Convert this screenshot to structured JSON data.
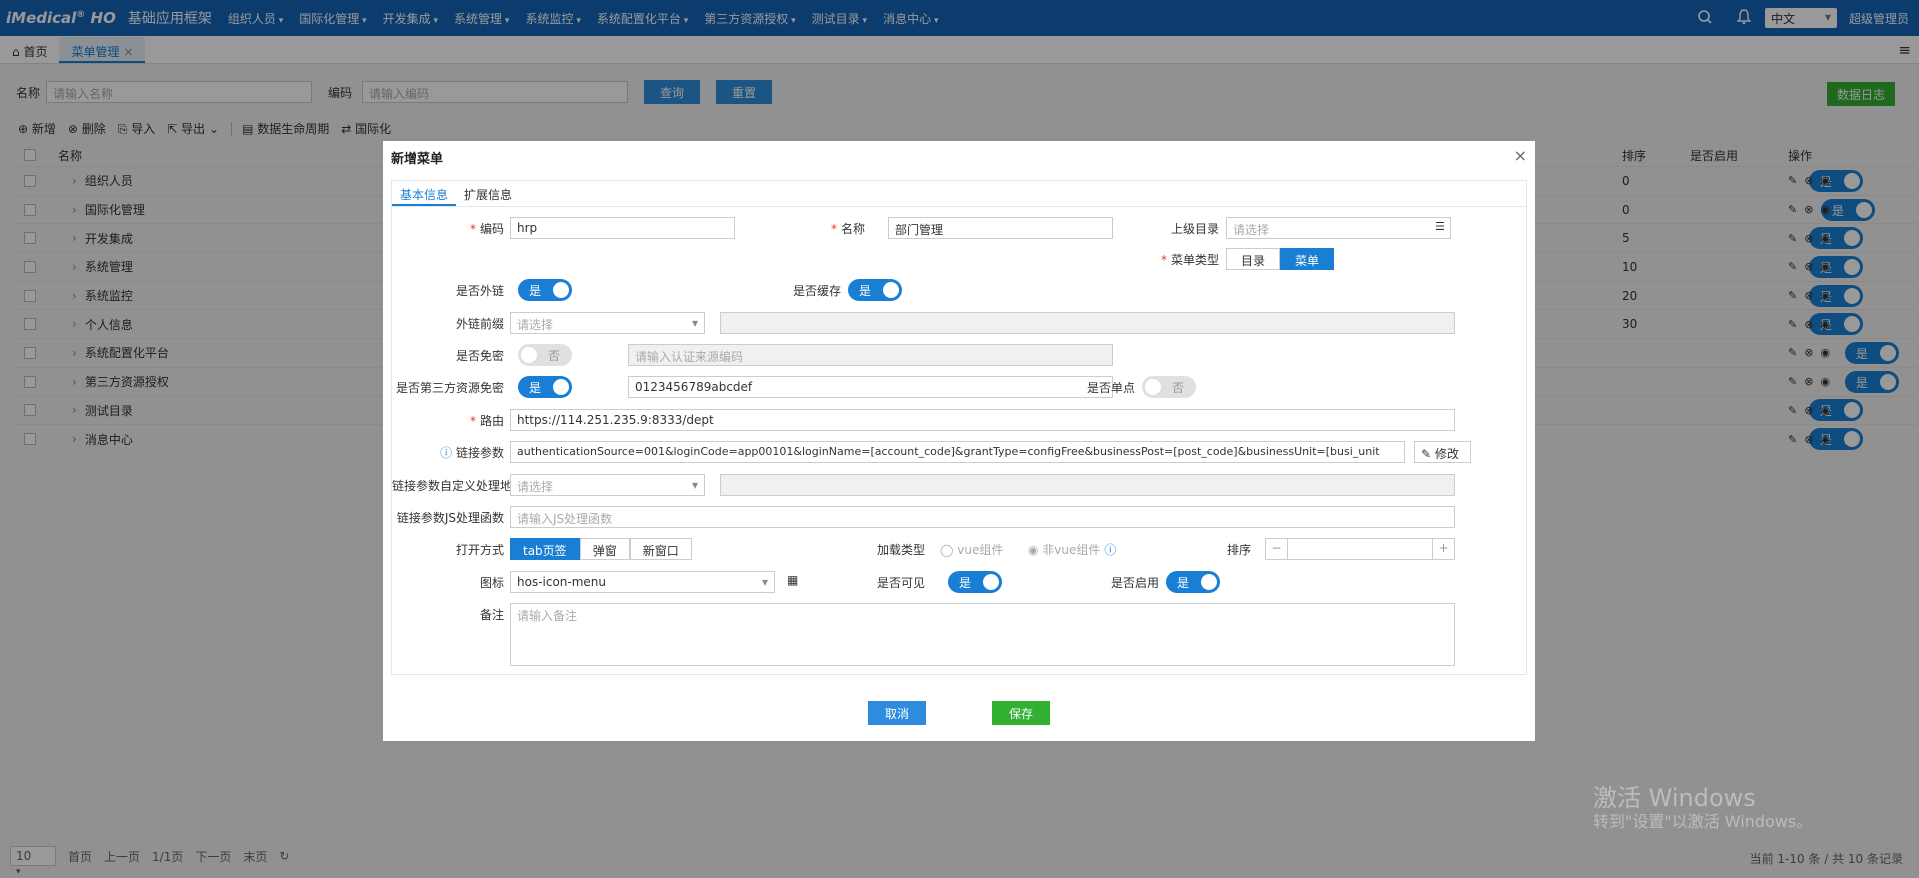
{
  "header": {
    "logo": "iMedical",
    "logo_sup": "®",
    "logo_suffix": "HO",
    "app_title": "基础应用框架",
    "nav": [
      "组织人员",
      "国际化管理",
      "开发集成",
      "系统管理",
      "系统监控",
      "系统配置化平台",
      "第三方资源授权",
      "测试目录",
      "消息中心"
    ],
    "language": "中文",
    "user": "超级管理员"
  },
  "tabs": {
    "home": "首页",
    "active": "菜单管理",
    "close": "×"
  },
  "search": {
    "name_label": "名称",
    "name_placeholder": "请输入名称",
    "code_label": "编码",
    "code_placeholder": "请输入编码",
    "query_btn": "查询",
    "reset_btn": "重置",
    "log_btn": "数据日志"
  },
  "toolbar": {
    "add": "新增",
    "delete": "删除",
    "import": "导入",
    "export": "导出",
    "lifecycle": "数据生命周期",
    "i18n": "国际化"
  },
  "table": {
    "headers": {
      "name": "名称",
      "sort": "排序",
      "enabled": "是否启用",
      "ops": "操作"
    },
    "rows": [
      {
        "name": "组织人员",
        "sort": "0",
        "enabled": "是"
      },
      {
        "name": "国际化管理",
        "sort": "0",
        "enabled": "是"
      },
      {
        "name": "开发集成",
        "sort": "5",
        "enabled": "是"
      },
      {
        "name": "系统管理",
        "sort": "10",
        "enabled": "是"
      },
      {
        "name": "系统监控",
        "sort": "20",
        "enabled": "是"
      },
      {
        "name": "个人信息",
        "sort": "30",
        "enabled": "是"
      },
      {
        "name": "系统配置化平台",
        "sort": "",
        "enabled": "是"
      },
      {
        "name": "第三方资源授权",
        "sort": "",
        "enabled": "是"
      },
      {
        "name": "测试目录",
        "sort": "",
        "enabled": "是"
      },
      {
        "name": "消息中心",
        "sort": "",
        "enabled": "是"
      }
    ]
  },
  "pager": {
    "size": "10",
    "first": "首页",
    "prev": "上一页",
    "page": "1/1页",
    "next": "下一页",
    "last": "末页",
    "info": "当前 1-10 条 / 共 10 条记录"
  },
  "watermark": {
    "line1": "激活 Windows",
    "line2": "转到\"设置\"以激活 Windows。"
  },
  "dialog": {
    "title": "新增菜单",
    "close": "×",
    "tabs": [
      "基本信息",
      "扩展信息"
    ],
    "fields": {
      "code": {
        "label": "编码",
        "value": "hrp"
      },
      "name": {
        "label": "名称",
        "value": "部门管理"
      },
      "parent": {
        "label": "上级目录",
        "placeholder": "请选择"
      },
      "menu_type": {
        "label": "菜单类型",
        "options": [
          "目录",
          "菜单"
        ],
        "selected": "菜单"
      },
      "is_external": {
        "label": "是否外链",
        "value": "是"
      },
      "is_cache": {
        "label": "是否缓存",
        "value": "是"
      },
      "ext_prefix": {
        "label": "外链前缀",
        "placeholder": "请选择"
      },
      "is_nologin": {
        "label": "是否免密",
        "value": "否",
        "placeholder": "请输入认证来源编码"
      },
      "third_party": {
        "label": "是否第三方资源免密",
        "value": "是",
        "input": "0123456789abcdef"
      },
      "single_point": {
        "label": "是否单点",
        "value": "否"
      },
      "route": {
        "label": "路由",
        "value": "https://114.251.235.9:8333/dept"
      },
      "link_params": {
        "label": "链接参数",
        "value": "authenticationSource=001&loginCode=app00101&loginName=[account_code]&grantType=configFree&businessPost=[post_code]&businessUnit=[busi_unit",
        "edit_btn": "修改"
      },
      "link_custom": {
        "label": "链接参数自定义处理地址",
        "placeholder": "请选择"
      },
      "link_js": {
        "label": "链接参数JS处理函数",
        "placeholder": "请输入JS处理函数"
      },
      "open_mode": {
        "label": "打开方式",
        "options": [
          "tab页签",
          "弹窗",
          "新窗口"
        ],
        "selected": "tab页签"
      },
      "load_type": {
        "label": "加载类型",
        "options": [
          "vue组件",
          "非vue组件"
        ]
      },
      "sort": {
        "label": "排序",
        "minus": "−",
        "plus": "+"
      },
      "icon": {
        "label": "图标",
        "value": "hos-icon-menu"
      },
      "visible": {
        "label": "是否可见",
        "value": "是"
      },
      "enabled": {
        "label": "是否启用",
        "value": "是"
      },
      "remark": {
        "label": "备注",
        "placeholder": "请输入备注"
      }
    },
    "cancel": "取消",
    "save": "保存"
  }
}
